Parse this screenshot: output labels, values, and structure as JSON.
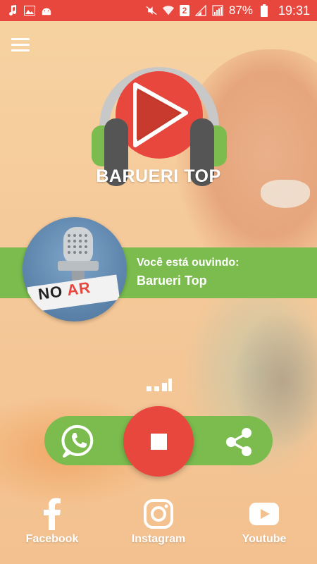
{
  "status_bar": {
    "left_icons": [
      "music-note-icon",
      "image-icon",
      "android-icon"
    ],
    "right_icons": [
      "mute-icon",
      "wifi-icon",
      "sim2-icon",
      "signal-icon",
      "signal-full-icon"
    ],
    "sim_badge": "2",
    "battery": "87%",
    "time": "19:31",
    "color": "#e8473e"
  },
  "header": {
    "menu_icon": "hamburger-menu-icon",
    "app_title": "BARUERI TOP"
  },
  "now_playing": {
    "label": "Você está ouvindo:",
    "station": "Barueri Top",
    "badge_text_no": "NO",
    "badge_text_ar": "AR",
    "band_color": "#7cbc4e"
  },
  "controls": {
    "whatsapp_icon": "whatsapp-icon",
    "stop_icon": "stop-icon",
    "share_icon": "share-icon",
    "stop_color": "#e8473e",
    "bar_color": "#7cbc4e"
  },
  "social": [
    {
      "icon": "facebook-icon",
      "label": "Facebook"
    },
    {
      "icon": "instagram-icon",
      "label": "Instagram"
    },
    {
      "icon": "youtube-icon",
      "label": "Youtube"
    }
  ]
}
